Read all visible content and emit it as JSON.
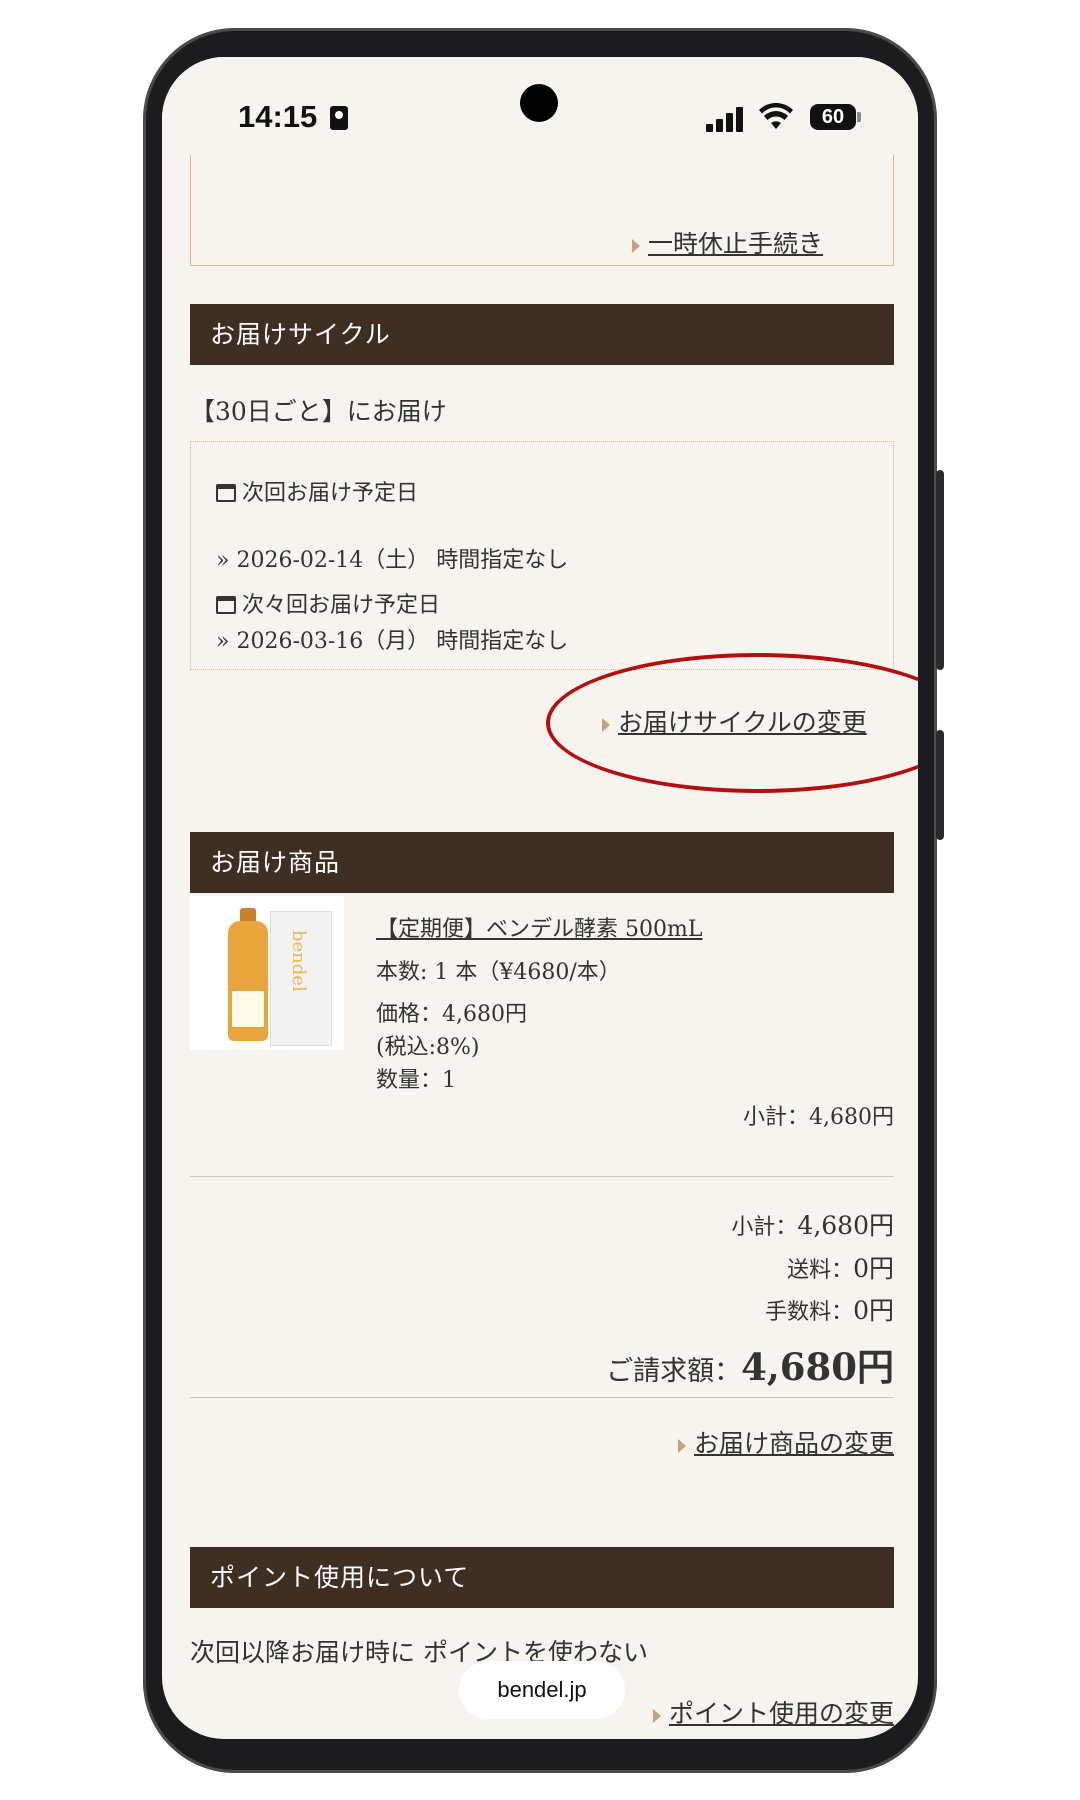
{
  "status": {
    "time": "14:15",
    "battery": "60"
  },
  "browser": {
    "url": "bendel.jp"
  },
  "pause_link": {
    "label": "一時休止手続き"
  },
  "delivery_cycle": {
    "heading": "お届けサイクル",
    "cycle_text": "【30日ごと】にお届け",
    "next_label": "次回お届け予定日",
    "next_date": "» 2026-02-14（土） 時間指定なし",
    "after_next_label": "次々回お届け予定日",
    "after_next_date": "» 2026-03-16（月） 時間指定なし",
    "change_link": "お届けサイクルの変更"
  },
  "products": {
    "heading": "お届け商品",
    "item": {
      "name": "【定期便】ベンデル酵素 500mL",
      "count_line": "本数: 1 本（¥4680/本）",
      "price_line": "価格：4,680円",
      "tax_line": "(税込:8%)",
      "qty_line": "数量：1",
      "subtotal_line": "小計：4,680円",
      "image_brand": "bendel"
    },
    "summary": {
      "subtotal_label": "小計：",
      "subtotal_value": "4,680円",
      "shipping_label": "送料：",
      "shipping_value": "0円",
      "fee_label": "手数料：",
      "fee_value": "0円",
      "total_label": "ご請求額：",
      "total_value": "4,680円"
    },
    "change_link": "お届け商品の変更"
  },
  "points": {
    "heading": "ポイント使用について",
    "text": "次回以降お届け時に ポイントを使わない",
    "change_link": "ポイント使用の変更"
  },
  "colors": {
    "header_bg": "#3f2e22",
    "accent_border": "#d9b78d",
    "highlight_oval": "#b30f0f",
    "page_bg": "#f7f4ef"
  }
}
